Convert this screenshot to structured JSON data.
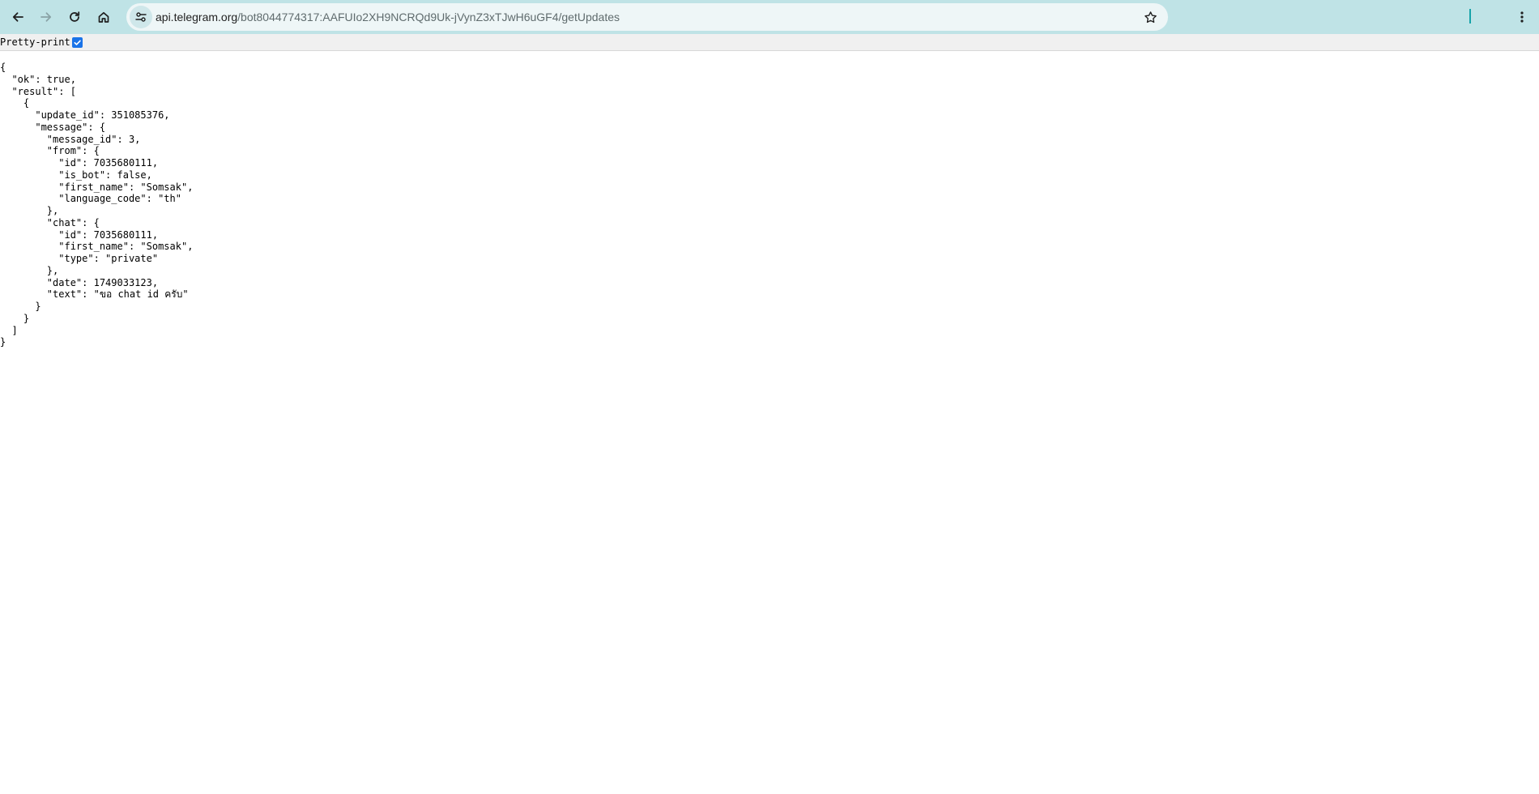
{
  "browser": {
    "url_host": "api.telegram.org",
    "url_path": "/bot8044774317:AAFUIo2XH9NCRQd9Uk-jVynZ3xTJwH6uGF4/getUpdates",
    "toolbar_color": "#bfe3e6",
    "icons": {
      "back": "arrow-left-icon",
      "forward": "arrow-right-icon",
      "reload": "reload-icon",
      "home": "home-icon",
      "site_info": "tune-icon",
      "bookmark": "star-icon",
      "menu": "kebab-menu-icon"
    }
  },
  "pretty_print": {
    "label": "Pretty-print",
    "checked": true
  },
  "json_lines": [
    "{",
    "  \"ok\": true,",
    "  \"result\": [",
    "    {",
    "      \"update_id\": 351085376,",
    "      \"message\": {",
    "        \"message_id\": 3,",
    "        \"from\": {",
    "          \"id\": 7035680111,",
    "          \"is_bot\": false,",
    "          \"first_name\": \"Somsak\",",
    "          \"language_code\": \"th\"",
    "        },",
    "        \"chat\": {",
    "          \"id\": 7035680111,",
    "          \"first_name\": \"Somsak\",",
    "          \"type\": \"private\"",
    "        },",
    "        \"date\": 1749033123,",
    "        \"text\": \"ขอ chat id ครับ\"",
    "      }",
    "    }",
    "  ]",
    "}"
  ]
}
